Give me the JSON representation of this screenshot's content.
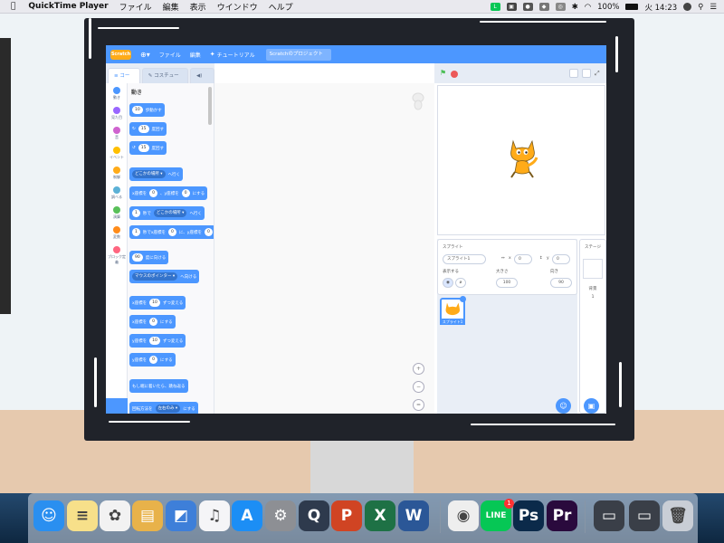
{
  "menubar": {
    "app": "QuickTime Player",
    "items": [
      "ファイル",
      "編集",
      "表示",
      "ウインドウ",
      "ヘルプ"
    ],
    "battery": "100%",
    "clock": "火 14:23"
  },
  "scratch": {
    "logo": "Scratch",
    "menu": {
      "file": "ファイル",
      "edit": "編集",
      "tutorial": "チュートリアル",
      "project": "Scratchのプロジェクト"
    },
    "tabs": [
      "コード",
      "コスチューム",
      "音"
    ],
    "categories": [
      {
        "label": "動き",
        "color": "#4c97ff"
      },
      {
        "label": "見た目",
        "color": "#9966ff"
      },
      {
        "label": "音",
        "color": "#cf63cf"
      },
      {
        "label": "イベント",
        "color": "#ffbf00"
      },
      {
        "label": "制御",
        "color": "#ffab19"
      },
      {
        "label": "調べる",
        "color": "#5cb1d6"
      },
      {
        "label": "演算",
        "color": "#59c059"
      },
      {
        "label": "変数",
        "color": "#ff8c1a"
      },
      {
        "label": "ブロック定義",
        "color": "#ff6680"
      }
    ],
    "palette_title": "動き",
    "blocks": {
      "move": {
        "n": "10",
        "t": "歩動かす"
      },
      "turn_r": {
        "icon": "↻",
        "n": "15",
        "t": "度回す"
      },
      "turn_l": {
        "icon": "↺",
        "n": "15",
        "t": "度回す"
      },
      "goto": {
        "dd": "どこかの場所 ▾",
        "t": "へ行く"
      },
      "gotoxy": {
        "a": "x座標を",
        "x": "0",
        "b": "、y座標を",
        "y": "0",
        "c": "にする"
      },
      "glide": {
        "n": "1",
        "a": "秒で",
        "dd": "どこかの場所 ▾",
        "t": "へ行く"
      },
      "glidexy": {
        "n": "1",
        "a": "秒でx座標を",
        "x": "0",
        "b": "に、y座標を",
        "y": "0"
      },
      "point": {
        "n": "90",
        "t": "度に向ける"
      },
      "pointto": {
        "dd": "マウスのポインター ▾",
        "t": "へ向ける"
      },
      "changex": {
        "a": "x座標を",
        "n": "10",
        "t": "ずつ変える"
      },
      "setx": {
        "a": "x座標を",
        "n": "0",
        "t": "にする"
      },
      "changey": {
        "a": "y座標を",
        "n": "10",
        "t": "ずつ変える"
      },
      "sety": {
        "a": "y座標を",
        "n": "0",
        "t": "にする"
      },
      "bounce": {
        "t": "もし端に着いたら、跳ね返る"
      },
      "rotstyle": {
        "a": "回転方法を",
        "dd": "左右のみ ▾",
        "t": "にする"
      }
    },
    "zoom": [
      "+",
      "−",
      "="
    ],
    "sprite_panel": {
      "sprite_label": "スプライト",
      "sprite_name": "スプライト1",
      "x_label": "x",
      "x": "0",
      "y_label": "y",
      "y": "0",
      "show_label": "表示する",
      "size_label": "大きさ",
      "size": "100",
      "dir_label": "向き",
      "direction": "90",
      "thumb_label": "スプライト1"
    },
    "stage_panel": {
      "title": "ステージ",
      "backdrop_label": "背景",
      "backdrop_count": "1"
    }
  },
  "dock": {
    "items": [
      {
        "name": "Finder",
        "color": "#2a8ff0",
        "glyph": "☺"
      },
      {
        "name": "メモ",
        "color": "#f7e08a",
        "glyph": "≡"
      },
      {
        "name": "写真",
        "color": "#f2f2f2",
        "glyph": "✿"
      },
      {
        "name": "プレビュー",
        "color": "#e8b24a",
        "glyph": "▤"
      },
      {
        "name": "Keynote",
        "color": "#3e7fd9",
        "glyph": "◩"
      },
      {
        "name": "iTunes",
        "color": "#f5f5f7",
        "glyph": "♫"
      },
      {
        "name": "App Store",
        "color": "#1c8ef5",
        "glyph": "A"
      },
      {
        "name": "システム環境設定",
        "color": "#8d8f94",
        "glyph": "⚙"
      },
      {
        "name": "QuickTime Player",
        "color": "#2e3a4d",
        "glyph": "Q"
      },
      {
        "name": "PowerPoint",
        "color": "#d04423",
        "glyph": "P"
      },
      {
        "name": "Excel",
        "color": "#1e7145",
        "glyph": "X"
      },
      {
        "name": "Word",
        "color": "#2b5797",
        "glyph": "W"
      },
      {
        "name": "Chrome",
        "color": "#eeeeee",
        "glyph": "◉"
      },
      {
        "name": "LINE",
        "color": "#06c755",
        "glyph": "LINE",
        "badge": "1"
      },
      {
        "name": "Photoshop",
        "color": "#0b2a4a",
        "glyph": "Ps"
      },
      {
        "name": "Premiere Pro",
        "color": "#2a0a3d",
        "glyph": "Pr"
      },
      {
        "name": "Window Pr",
        "color": "#3a3f48",
        "glyph": "▭"
      },
      {
        "name": "Window Ps",
        "color": "#3a3f48",
        "glyph": "▭"
      },
      {
        "name": "ゴミ箱",
        "color": "#c9ced6",
        "glyph": "🗑"
      }
    ]
  }
}
